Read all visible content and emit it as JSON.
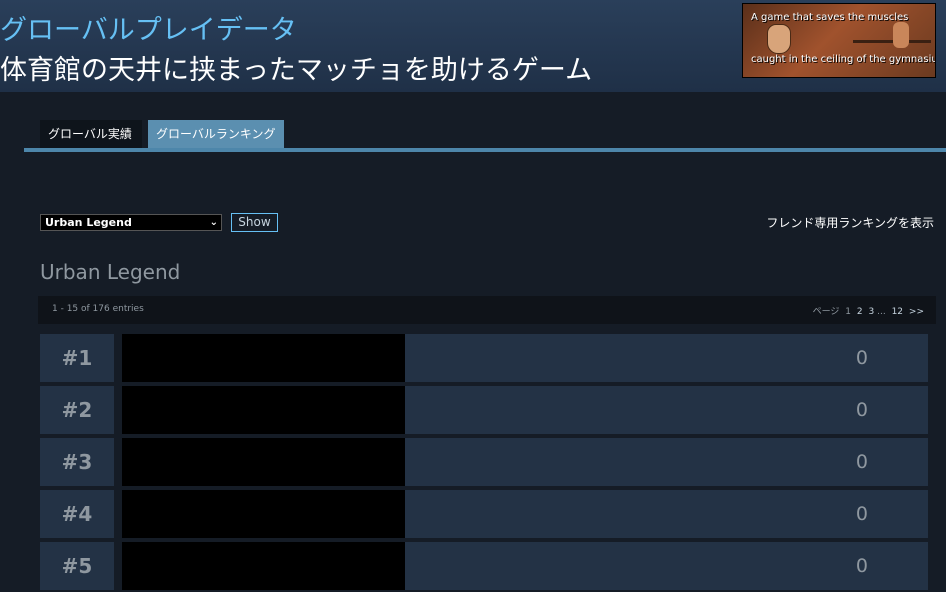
{
  "header": {
    "title_line1": "グローバルプレイデータ",
    "title_line2": "体育館の天井に挟まったマッチョを助けるゲーム",
    "banner_line1": "A game that saves the muscles",
    "banner_line2": "caught in the ceiling of the gymnasium"
  },
  "tabs": [
    {
      "label": "グローバル実績"
    },
    {
      "label": "グローバルランキング"
    }
  ],
  "filter": {
    "selected": "Urban Legend",
    "show_label": "Show",
    "friend_link": "フレンド専用ランキングを表示"
  },
  "section_title": "Urban Legend",
  "entries_text": "1 - 15 of 176 entries",
  "pager": {
    "prefix": "ページ",
    "current": "1",
    "pages": [
      "2",
      "3"
    ],
    "ellipsis": "...",
    "last": "12",
    "next": ">>"
  },
  "ranks": [
    {
      "rank": "#1",
      "score": "0"
    },
    {
      "rank": "#2",
      "score": "0"
    },
    {
      "rank": "#3",
      "score": "0"
    },
    {
      "rank": "#4",
      "score": "0"
    },
    {
      "rank": "#5",
      "score": "0"
    }
  ]
}
